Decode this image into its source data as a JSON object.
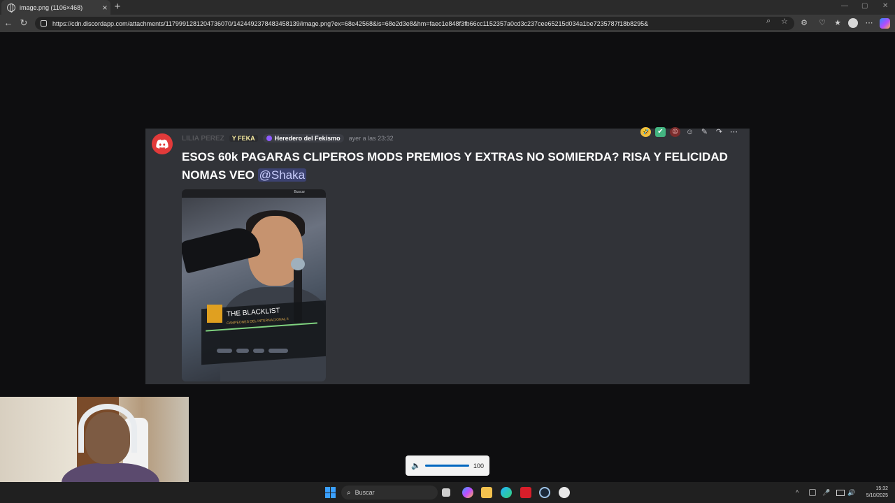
{
  "browser": {
    "tab_title": "image.png (1106×468)",
    "tab_close": "×",
    "new_tab": "+",
    "url": "https://cdn.discordapp.com/attachments/1179991281204736070/1424492378483458139/image.png?ex=68e42568&is=68e2d3e8&hm=faec1e848f3fb66cc1152357a0cd3c237cee65215d034a1be7235787f18b8295&",
    "nav": {
      "back": "←",
      "reload": "↻"
    },
    "window_controls": {
      "minimize": "—",
      "maximize": "▢",
      "close": "✕"
    }
  },
  "message": {
    "username": "LILIA PEREZ",
    "tag": "Y FEKA",
    "role": "Heredero del Fekismo",
    "timestamp": "ayer a las 23:32",
    "text": "ESOS 60k PAGARAS CLIPEROS MODS PREMIOS Y EXTRAS NO SOMIERDA? RISA Y FELICIDAD NOMAS VEO ",
    "mention": "@Shaka",
    "actions": {
      "react1": "🤣",
      "react2": "✔",
      "react3": "☹",
      "add_reaction": "☺",
      "edit": "✎",
      "forward": "↷",
      "more": "⋯"
    }
  },
  "embed_image": {
    "search_label": "Buscar",
    "overlay_title": "THE BLACKLIST",
    "overlay_subtitle": "CAMPEONES DEL INTERNACIONAL II"
  },
  "volume": {
    "icon": "🔈",
    "level": 100,
    "level_label": "100"
  },
  "taskbar": {
    "search_placeholder": "Buscar",
    "search_icon": "⌕",
    "time": "15:32",
    "date": "5/10/2025",
    "tray": {
      "chevron": "^",
      "mic": "🎤",
      "volume": "🔊"
    }
  },
  "colors": {
    "accent": "#0067c0",
    "discord_red": "#e23a3a",
    "mention_bg": "#3c4270"
  }
}
